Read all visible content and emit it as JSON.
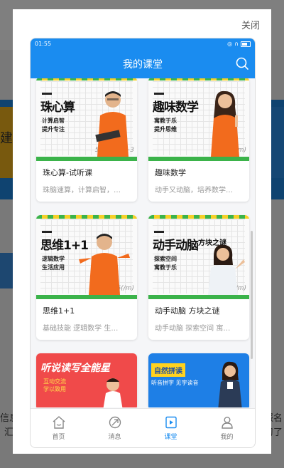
{
  "background": {
    "left_snippet": "建-",
    "bottom_left": [
      "信息",
      "汇"
    ],
    "bottom_right": [
      "报名",
      "习了"
    ]
  },
  "modal": {
    "close_label": "关闭"
  },
  "phone": {
    "status_time": "01:55",
    "title": "我的课堂",
    "accent": "#1a8cf0"
  },
  "courses": [
    {
      "thumb_title": "珠心算",
      "thumb_sub": [
        "计算启智",
        "提升专注"
      ],
      "scribble": "5(/m) 34-+3",
      "title": "珠心算-试听课",
      "desc": "珠脑速算，计算启智，…"
    },
    {
      "thumb_title": "趣味数学",
      "thumb_sub": [
        "寓教于乐",
        "提升思维"
      ],
      "scribble": "5(/m)",
      "title": "趣味数学",
      "desc": "动手又动脑，培养数学…"
    },
    {
      "thumb_title": "思维1+1",
      "thumb_sub": [
        "逻辑数学",
        "生活应用"
      ],
      "scribble": "5(/m)",
      "title": "思维1+1",
      "desc": "基础技能 逻辑数学 生…"
    },
    {
      "thumb_title": "动手动脑",
      "thumb_title2": "方块之谜",
      "thumb_sub": [
        "探索空间",
        "寓教于乐"
      ],
      "scribble": "5(/m)",
      "title": "动手动脑 方块之谜",
      "desc": "动手动脑 探索空间 寓…"
    }
  ],
  "promos": [
    {
      "headline": "听说读写全能星",
      "sub": [
        "互动交流",
        "学以致用"
      ]
    },
    {
      "headline": "自然拼读",
      "sub": "听音拼字 见字读音"
    }
  ],
  "tabs": [
    {
      "label": "首页",
      "icon": "home-icon",
      "active": false
    },
    {
      "label": "消息",
      "icon": "message-icon",
      "active": false
    },
    {
      "label": "课堂",
      "icon": "classroom-icon",
      "active": true
    },
    {
      "label": "我的",
      "icon": "profile-icon",
      "active": false
    }
  ]
}
